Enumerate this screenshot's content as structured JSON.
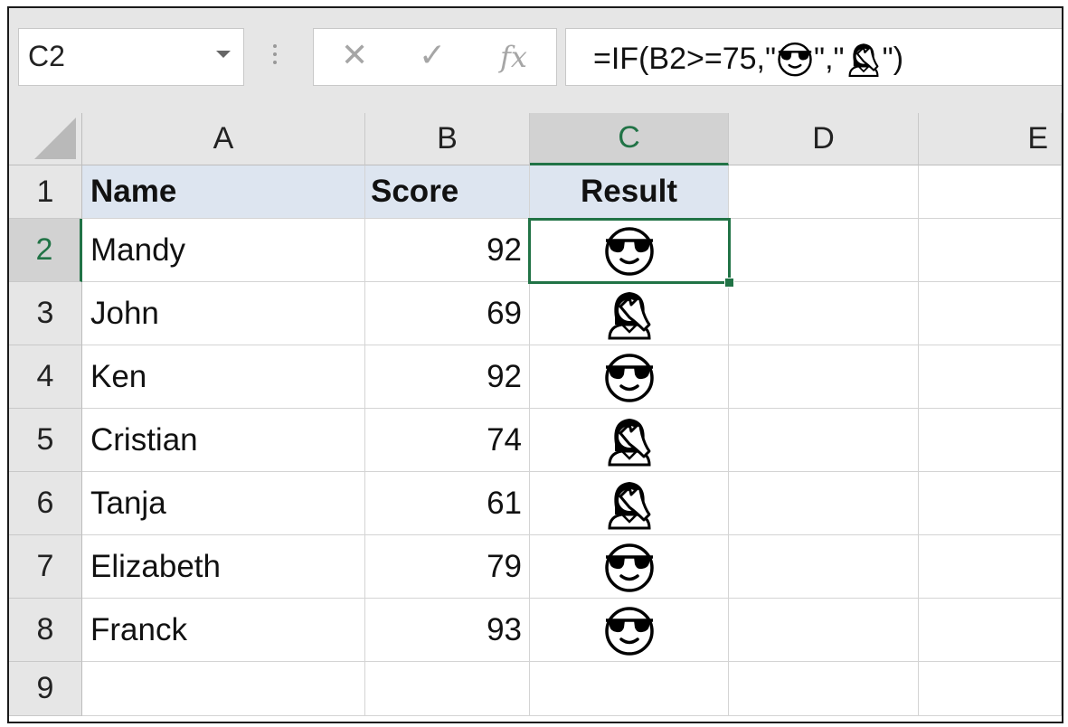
{
  "formula_bar": {
    "name_box": "C2",
    "cancel_glyph": "✕",
    "enter_glyph": "✓",
    "fx_label": "fx",
    "formula_prefix": "=IF(B2>=75,\"",
    "formula_mid": "\",\"",
    "formula_suffix": "\")",
    "icons": [
      "sunglasses-face-icon",
      "facepalm-woman-icon"
    ]
  },
  "columns": [
    "A",
    "B",
    "C",
    "D",
    "E"
  ],
  "selected_column": "C",
  "rows": [
    "1",
    "2",
    "3",
    "4",
    "5",
    "6",
    "7",
    "8",
    "9"
  ],
  "selected_row": "2",
  "selected_cell": "C2",
  "header_row": {
    "a": "Name",
    "b": "Score",
    "c": "Result"
  },
  "records": [
    {
      "name": "Mandy",
      "score": "92",
      "result_icon": "sunglasses-face-icon"
    },
    {
      "name": "John",
      "score": "69",
      "result_icon": "facepalm-woman-icon"
    },
    {
      "name": "Ken",
      "score": "92",
      "result_icon": "sunglasses-face-icon"
    },
    {
      "name": "Cristian",
      "score": "74",
      "result_icon": "facepalm-woman-icon"
    },
    {
      "name": "Tanja",
      "score": "61",
      "result_icon": "facepalm-woman-icon"
    },
    {
      "name": "Elizabeth",
      "score": "79",
      "result_icon": "sunglasses-face-icon"
    },
    {
      "name": "Franck",
      "score": "93",
      "result_icon": "sunglasses-face-icon"
    }
  ],
  "colors": {
    "selection": "#217346",
    "header_fill": "#dde5f0",
    "chrome": "#e6e6e6"
  }
}
